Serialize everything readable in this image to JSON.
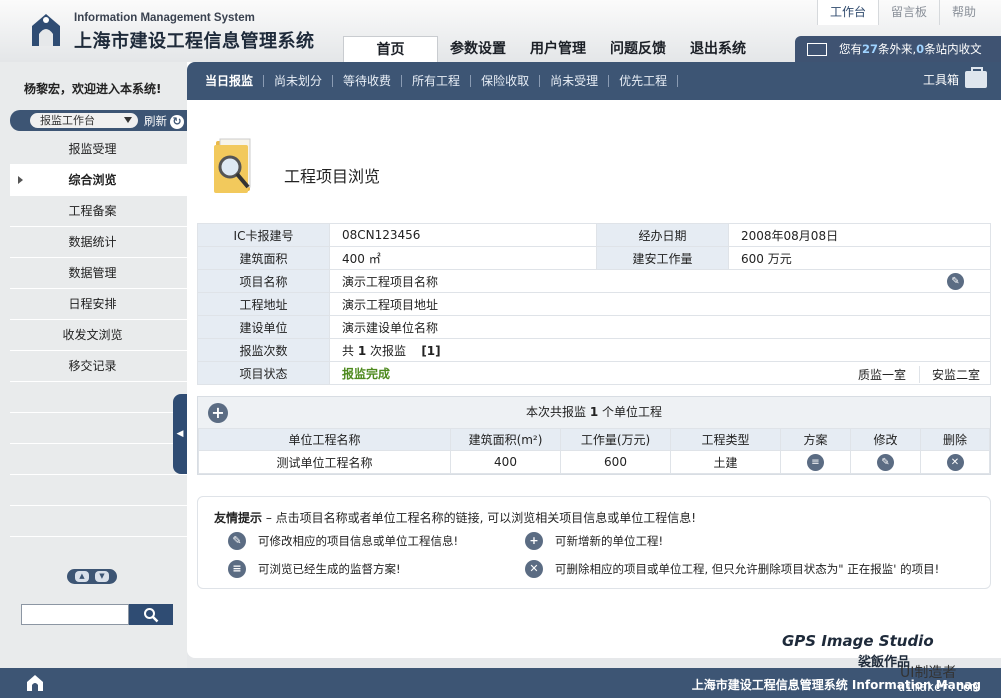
{
  "header": {
    "logo_en": "Information Management System",
    "logo_cn": "上海市建设工程信息管理系统",
    "top_tabs": [
      "工作台",
      "留言板",
      "帮助"
    ],
    "nav": [
      "首页",
      "参数设置",
      "用户管理",
      "问题反馈",
      "退出系统"
    ],
    "msg_prefix": "您有",
    "msg_outer": "27",
    "msg_mid": "条外来,",
    "msg_inner": "0",
    "msg_suffix": "条站内收文"
  },
  "sidebar": {
    "welcome": "杨黎宏，欢迎进入本系统!",
    "workbench_select": "报监工作台",
    "refresh": "刷新",
    "menu": [
      "报监受理",
      "综合浏览",
      "工程备案",
      "数据统计",
      "数据管理",
      "日程安排",
      "收发文浏览",
      "移交记录"
    ],
    "search_placeholder": ""
  },
  "subnav": {
    "items": [
      "当日报监",
      "尚未划分",
      "等待收费",
      "所有工程",
      "保险收取",
      "尚未受理",
      "优先工程"
    ],
    "toolbox": "工具箱"
  },
  "page_title": "工程项目浏览",
  "project_info": {
    "ic_label": "IC卡报建号",
    "ic_value": "08CN123456",
    "date_label": "经办日期",
    "date_value": "2008年08月08日",
    "area_label": "建筑面积",
    "area_value": "400 ㎡",
    "work_label": "建安工作量",
    "work_value": "600 万元",
    "name_label": "项目名称",
    "name_value": "演示工程项目名称",
    "addr_label": "工程地址",
    "addr_value": "演示工程项目地址",
    "unit_label": "建设单位",
    "unit_value": "演示建设单位名称",
    "count_label": "报监次数",
    "count_prefix": "共",
    "count_num": "1",
    "count_suffix": "次报监",
    "count_link": "[1]",
    "status_label": "项目状态",
    "status_value": "报监完成",
    "office1": "质监一室",
    "office2": "安监二室"
  },
  "units": {
    "summary_prefix": "本次共报监",
    "summary_num": "1",
    "summary_suffix": "个单位工程",
    "columns": [
      "单位工程名称",
      "建筑面积(m²)",
      "工作量(万元)",
      "工程类型",
      "方案",
      "修改",
      "删除"
    ],
    "rows": [
      {
        "name": "测试单位工程名称",
        "area": "400",
        "work": "600",
        "type": "土建"
      }
    ]
  },
  "tips": {
    "title": "友情提示",
    "intro": " – 点击项目名称或者单位工程名称的链接, 可以浏览相关项目信息或单位工程信息!",
    "edit_tip": "可修改相应的项目信息或单位工程信息!",
    "add_tip": "可新增新的单位工程!",
    "view_tip": "可浏览已经生成的监督方案!",
    "delete_tip": "可删除相应的项目或单位工程, 但只允许删除项目状态为\" 正在报监' 的项目!"
  },
  "footer": {
    "text": "上海市建设工程信息管理系统 Information Manag"
  },
  "brand": {
    "studio": "GPS Image Studio",
    "work": "裟飯作品",
    "uimaker": "UI制造者",
    "url": "uimaker.com"
  }
}
